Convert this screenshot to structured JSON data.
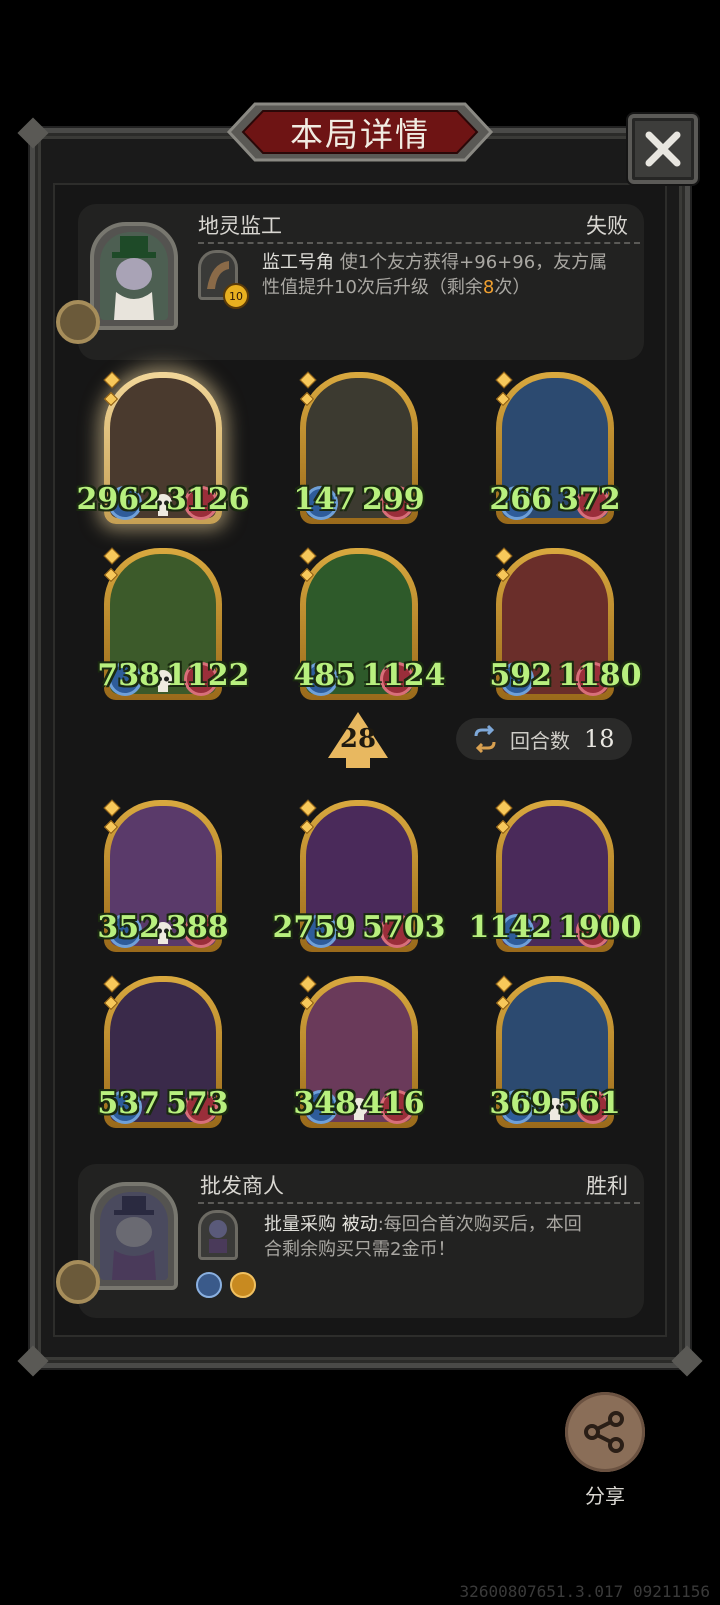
{
  "title": "本局详情",
  "close_label": "✕",
  "opponent": {
    "name": "地灵监工",
    "result": "失败",
    "skill_name": "监工号角",
    "skill_desc_1": "使1个友方获得+96+96，友方属",
    "skill_desc_2a": "性值提升10次后升级（剩余",
    "skill_desc_2b": "8",
    "skill_desc_2c": "次）",
    "skill_badge": "10"
  },
  "opponent_units": [
    {
      "atk": "2962",
      "hp": "3126",
      "skull": true,
      "color": "#4a3a2e"
    },
    {
      "atk": "147",
      "hp": "299",
      "skull": false,
      "color": "#3c3a30"
    },
    {
      "atk": "266",
      "hp": "372",
      "skull": false,
      "color": "#2c4a70"
    },
    {
      "atk": "738",
      "hp": "1122",
      "skull": true,
      "color": "#3c5a2a"
    },
    {
      "atk": "485",
      "hp": "1124",
      "skull": false,
      "color": "#2e5a2a"
    },
    {
      "atk": "592",
      "hp": "1180",
      "skull": false,
      "color": "#6a2e2a"
    }
  ],
  "level": "28",
  "round": {
    "label": "回合数",
    "value": "18"
  },
  "player_units": [
    {
      "atk": "352",
      "hp": "388",
      "skull": true,
      "color": "#5a3a6a"
    },
    {
      "atk": "2759",
      "hp": "5703",
      "skull": false,
      "color": "#4a2a5a"
    },
    {
      "atk": "1142",
      "hp": "1900",
      "skull": false,
      "color": "#4a2a5a"
    },
    {
      "atk": "537",
      "hp": "573",
      "skull": false,
      "color": "#3a2a4a"
    },
    {
      "atk": "348",
      "hp": "416",
      "skull": true,
      "color": "#6a3a5a"
    },
    {
      "atk": "369",
      "hp": "561",
      "skull": true,
      "color": "#2c4a70"
    }
  ],
  "player": {
    "name": "批发商人",
    "result": "胜利",
    "skill_name": "批量采购",
    "skill_type": "被动",
    "skill_desc_1": ":每回合首次购买后，本回",
    "skill_desc_2": "合剩余购买只需2金币！"
  },
  "share_label": "分享",
  "version": "32600807651.3.017 09211156"
}
